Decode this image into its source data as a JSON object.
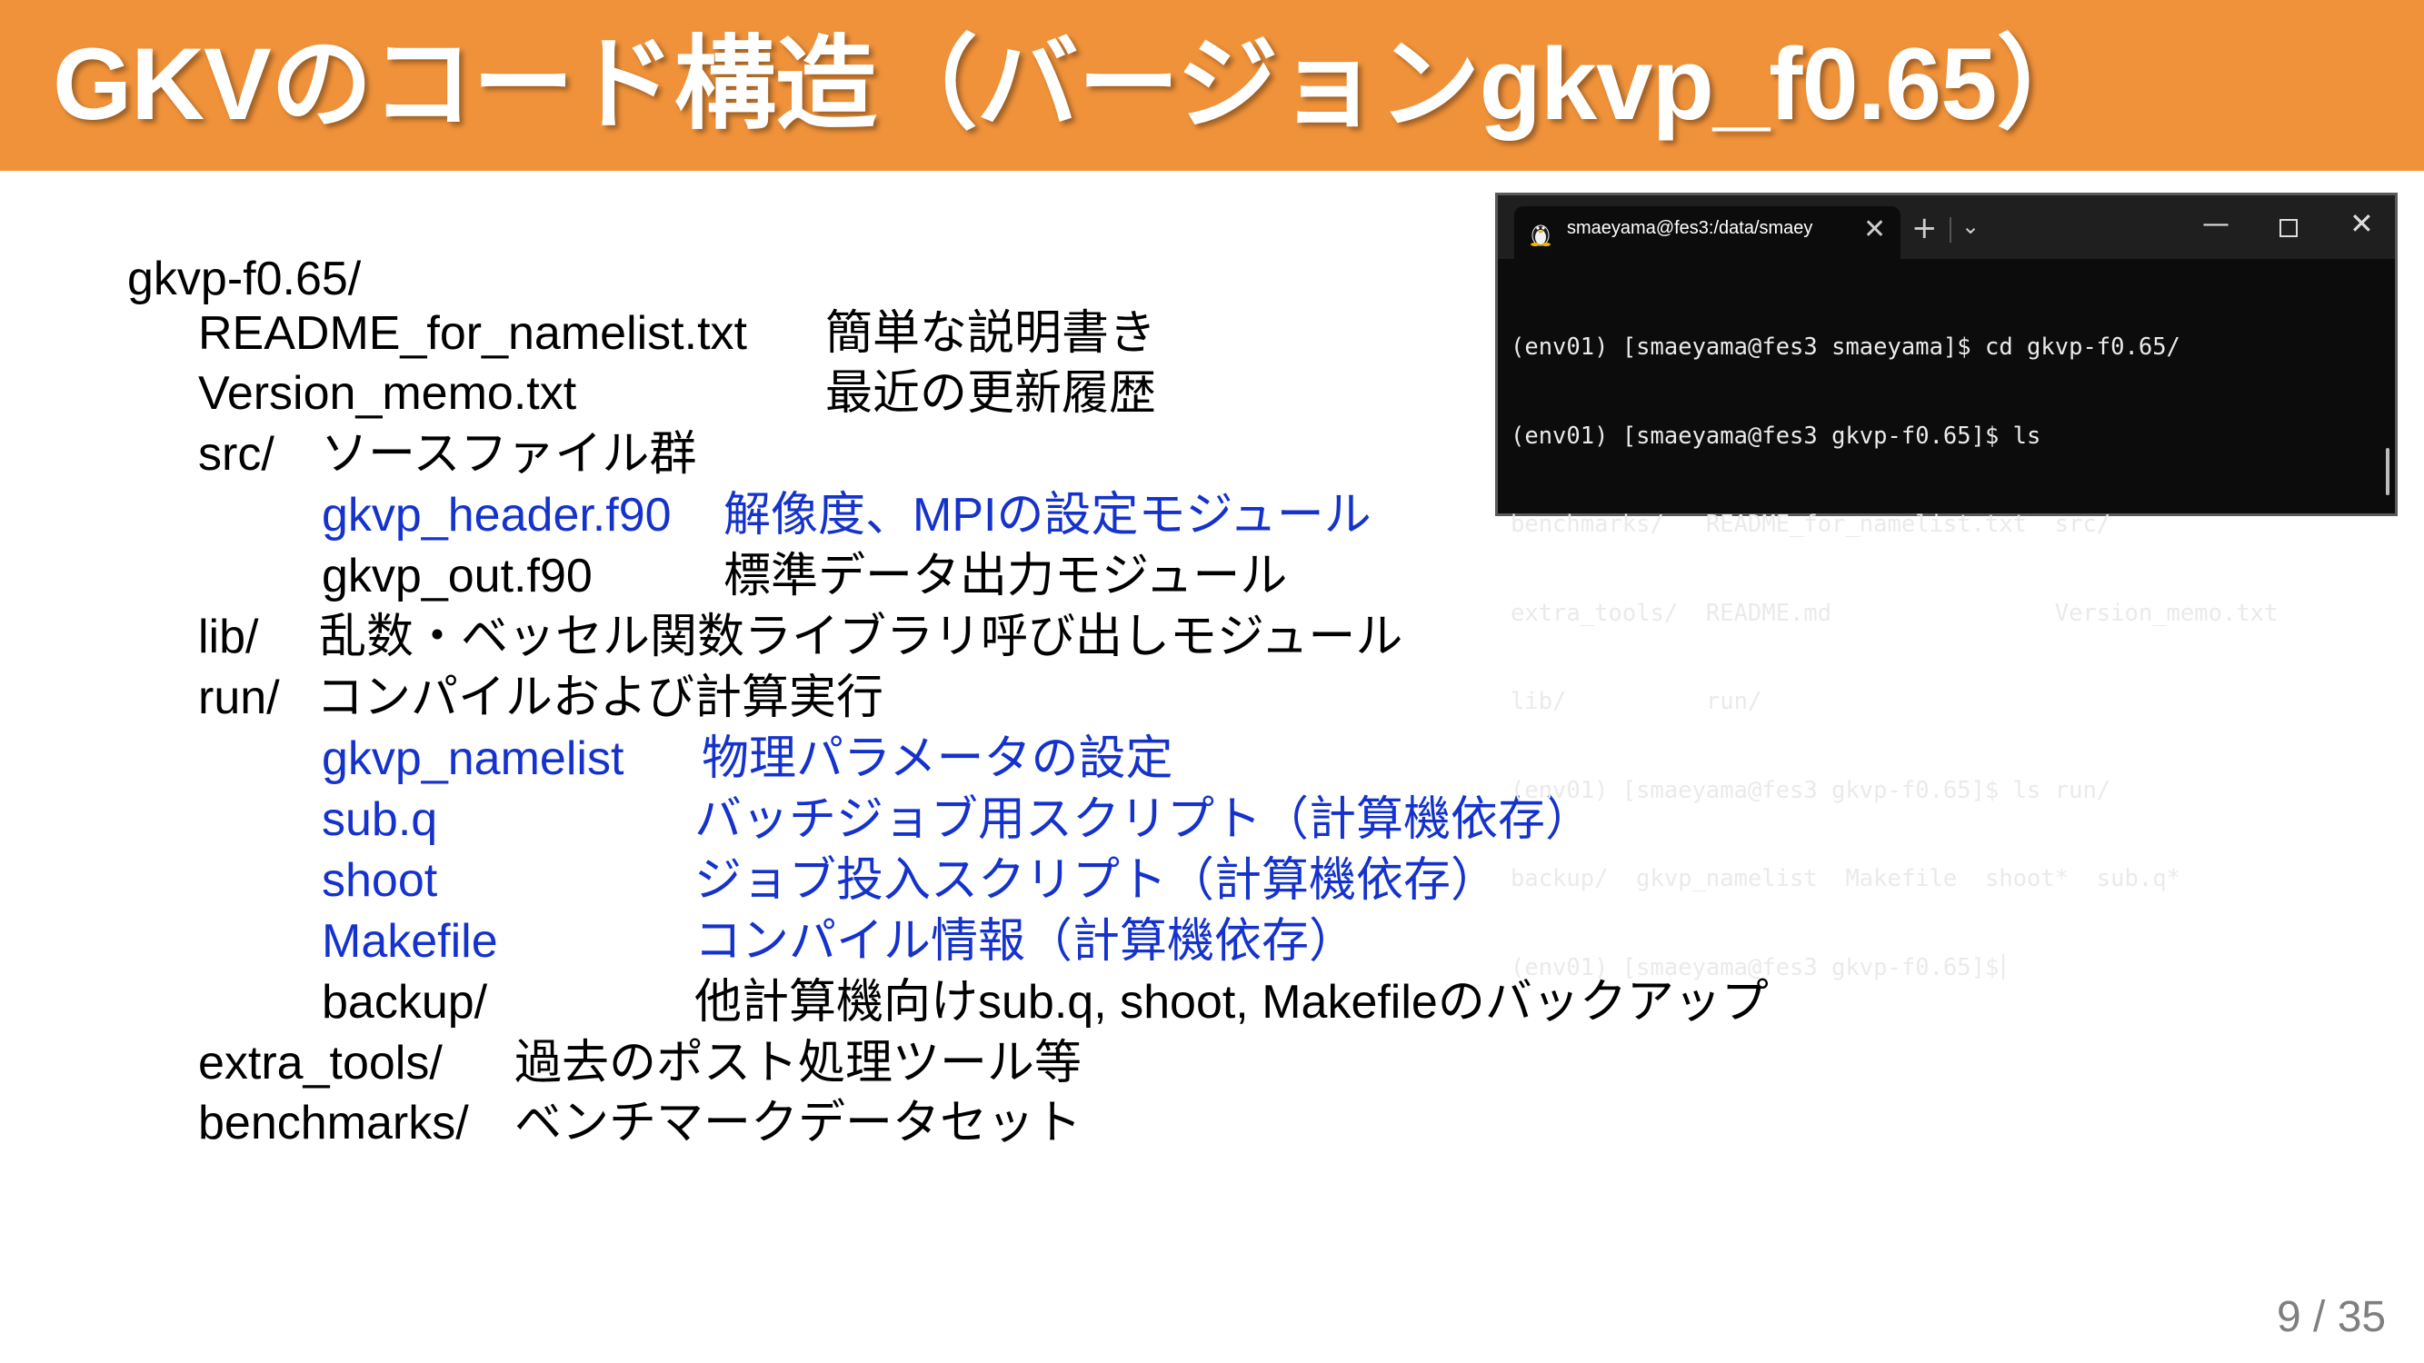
{
  "title": "GKVのコード構造（バージョンgkvp_f0.65）",
  "colors": {
    "title_bar": "#F0923A",
    "highlight": "#1533CC",
    "text": "#000000"
  },
  "tree": {
    "root": "gkvp-f0.65/",
    "readme": {
      "name": "README_for_namelist.txt",
      "desc": "簡単な説明書き"
    },
    "version": {
      "name": "Version_memo.txt",
      "desc": "最近の更新履歴"
    },
    "src": {
      "name": "src/",
      "desc": "ソースファイル群"
    },
    "header": {
      "name": "gkvp_header.f90",
      "desc": "解像度、MPIの設定モジュール"
    },
    "out": {
      "name": "gkvp_out.f90",
      "desc": "標準データ出力モジュール"
    },
    "lib": {
      "name": "lib/",
      "desc": "乱数・ベッセル関数ライブラリ呼び出しモジュール"
    },
    "run": {
      "name": "run/",
      "desc": "コンパイルおよび計算実行"
    },
    "namelist": {
      "name": "gkvp_namelist",
      "desc": "物理パラメータの設定"
    },
    "subq": {
      "name": "sub.q",
      "desc": "バッチジョブ用スクリプト（計算機依存）"
    },
    "shoot": {
      "name": "shoot",
      "desc": "ジョブ投入スクリプト（計算機依存）"
    },
    "makefile": {
      "name": "Makefile",
      "desc": "コンパイル情報（計算機依存）"
    },
    "backup": {
      "name": "backup/",
      "desc": "他計算機向けsub.q, shoot, Makefileのバックアップ"
    },
    "extra": {
      "name": "extra_tools/",
      "desc": "過去のポスト処理ツール等"
    },
    "bench": {
      "name": "benchmarks/",
      "desc": "ベンチマークデータセット"
    }
  },
  "terminal": {
    "tab_title": "smaeyama@fes3:/data/smaey",
    "tab_icon": "linux-tux-icon",
    "close_glyph": "✕",
    "new_tab_glyph": "+",
    "menu_glyph": "⌄",
    "min_glyph": "—",
    "winclose_glyph": "✕",
    "lines": [
      "(env01) [smaeyama@fes3 smaeyama]$ cd gkvp-f0.65/",
      "(env01) [smaeyama@fes3 gkvp-f0.65]$ ls",
      "benchmarks/   README_for_namelist.txt  src/",
      "extra_tools/  README.md                Version_memo.txt",
      "lib/          run/",
      "(env01) [smaeyama@fes3 gkvp-f0.65]$ ls run/",
      "backup/  gkvp_namelist  Makefile  shoot*  sub.q*",
      "(env01) [smaeyama@fes3 gkvp-f0.65]$"
    ]
  },
  "page_number": "9 / 35"
}
